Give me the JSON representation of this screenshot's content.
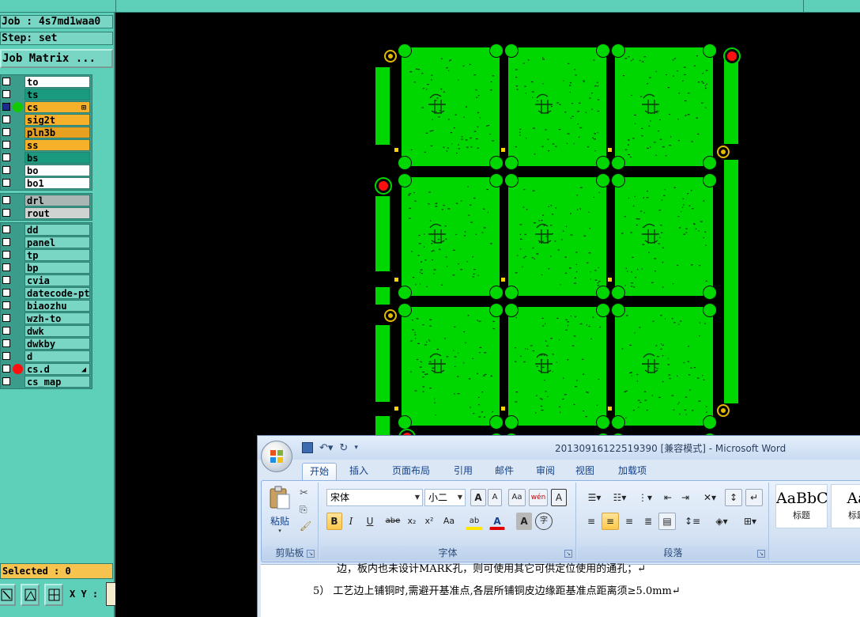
{
  "genesis": {
    "job_label": "Job : 4s7md1waa0",
    "step_label": "Step: set",
    "job_matrix_button": "Job Matrix ...",
    "layers_board": [
      {
        "name": "to",
        "color": "#ffffff",
        "dot": "",
        "checked": false
      },
      {
        "name": "ts",
        "color": "#1a9a7e",
        "dot": "",
        "checked": false
      },
      {
        "name": "cs",
        "color": "#f7b02a",
        "dot": "#14c800",
        "checked": true,
        "mark": "⊞"
      },
      {
        "name": "sig2t",
        "color": "#f7b02a",
        "dot": "",
        "checked": false
      },
      {
        "name": "pln3b",
        "color": "#e8a020",
        "dot": "",
        "checked": false
      },
      {
        "name": "ss",
        "color": "#f7b02a",
        "dot": "",
        "checked": false
      },
      {
        "name": "bs",
        "color": "#1a9a7e",
        "dot": "",
        "checked": false
      },
      {
        "name": "bo",
        "color": "#ffffff",
        "dot": "",
        "checked": false
      },
      {
        "name": "bo1",
        "color": "#ffffff",
        "dot": "",
        "checked": false
      }
    ],
    "layers_drill": [
      {
        "name": "drl",
        "color": "#a9b6b4",
        "dot": "",
        "checked": false
      },
      {
        "name": "rout",
        "color": "#cfd4d3",
        "dot": "",
        "checked": false
      }
    ],
    "layers_misc": [
      {
        "name": "dd",
        "color": "#79d6c5",
        "dot": "",
        "checked": false
      },
      {
        "name": "panel",
        "color": "#79d6c5",
        "dot": "",
        "checked": false
      },
      {
        "name": "tp",
        "color": "#79d6c5",
        "dot": "",
        "checked": false
      },
      {
        "name": "bp",
        "color": "#79d6c5",
        "dot": "",
        "checked": false
      },
      {
        "name": "cvia",
        "color": "#79d6c5",
        "dot": "",
        "checked": false
      },
      {
        "name": "datecode-ptc",
        "color": "#79d6c5",
        "dot": "",
        "checked": false
      },
      {
        "name": "biaozhu",
        "color": "#79d6c5",
        "dot": "",
        "checked": false
      },
      {
        "name": "wzh-to",
        "color": "#79d6c5",
        "dot": "",
        "checked": false
      },
      {
        "name": "dwk",
        "color": "#79d6c5",
        "dot": "",
        "checked": false
      },
      {
        "name": "dwkby",
        "color": "#79d6c5",
        "dot": "",
        "checked": false
      },
      {
        "name": "d",
        "color": "#79d6c5",
        "dot": "",
        "checked": false
      },
      {
        "name": "cs.d",
        "color": "#79d6c5",
        "dot": "#ff1010",
        "checked": false,
        "mark": "◢"
      },
      {
        "name": "cs_map",
        "color": "#79d6c5",
        "dot": "",
        "checked": false
      }
    ],
    "selected_label": "Selected : 0",
    "xy_label": "X Y :",
    "xy_value": "",
    "colors": {
      "panel_bg": "#5ecfb9",
      "copper": "#00d600",
      "canvas": "#000000"
    }
  },
  "word": {
    "title": "20130916122519390 [兼容模式] - Microsoft Word",
    "tabs": [
      "开始",
      "插入",
      "页面布局",
      "引用",
      "邮件",
      "审阅",
      "视图",
      "加载项"
    ],
    "active_tab": "开始",
    "clipboard": {
      "paste_label": "粘贴",
      "group_label": "剪贴板"
    },
    "font": {
      "name": "宋体",
      "size": "小二",
      "group_label": "字体",
      "grow": "A",
      "shrink": "A",
      "clear": "Aa",
      "phonetic": "wén",
      "border_char": "A",
      "bold": "B",
      "italic": "I",
      "underline": "U",
      "strike": "abe",
      "sub": "x₂",
      "sup": "x²",
      "case": "Aa",
      "highlight": "ab",
      "color": "A",
      "shade": "A",
      "enclose": "字"
    },
    "paragraph": {
      "group_label": "段落"
    },
    "styles": [
      {
        "sample": "AaBbC",
        "name": "标题"
      },
      {
        "sample": "Aa",
        "name": "标题"
      }
    ],
    "doc_lines": [
      "边，板内也未设计MARK孔，则可使用其它可供定位使用的通孔；↵",
      "5）  工艺边上铺铜时,需避开基准点,各层所铺铜皮边缘距基准点距离须≥5.0mm↵"
    ]
  }
}
